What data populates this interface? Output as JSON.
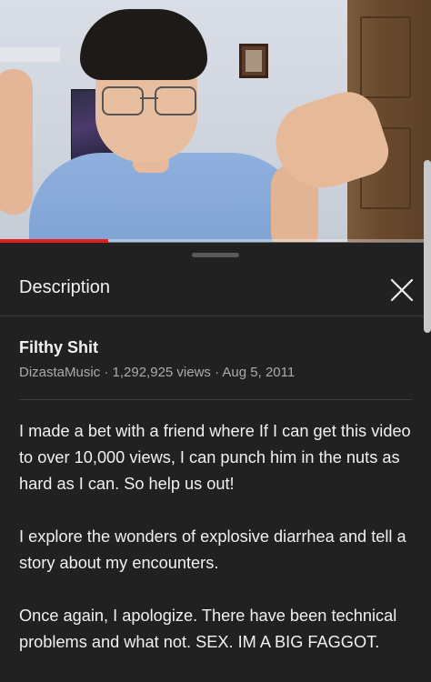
{
  "video": {
    "progress_fraction": 0.25
  },
  "description_panel": {
    "header_title": "Description",
    "close_icon": "close-icon",
    "video_title": "Filthy Shit",
    "meta": "DizastaMusic · 1,292,925 views · Aug 5, 2011",
    "paragraphs": [
      "I made a bet with a friend where If I can get this video to over 10,000 views, I can punch him in the nuts as hard as I can. So help us out!",
      "I explore the wonders of explosive diarrhea and tell a story about my encounters.",
      "Once again, I apologize. There have been technical problems and what not. SEX. IM A BIG FAGGOT."
    ]
  },
  "colors": {
    "background": "#212121",
    "progress": "#e0201e",
    "secondary_text": "#aaaaaa"
  }
}
